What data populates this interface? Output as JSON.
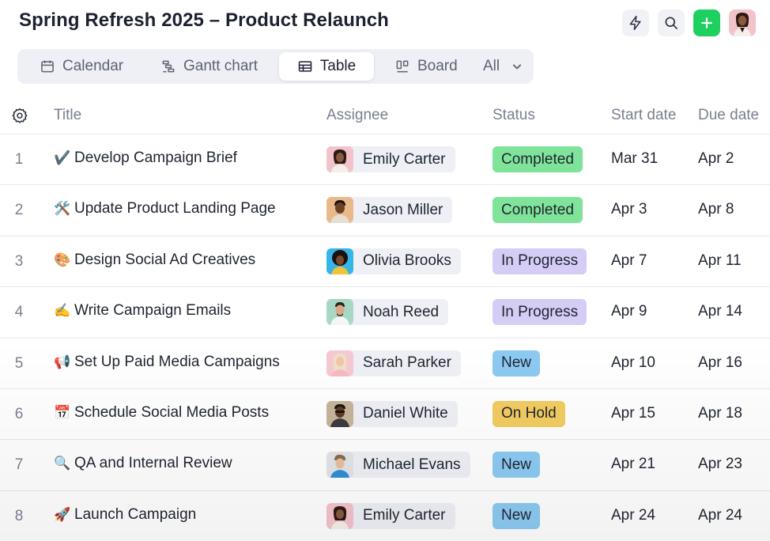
{
  "header": {
    "title": "Spring Refresh 2025 – Product Relaunch",
    "icons": {
      "automation": "bolt-icon",
      "search": "search-icon",
      "add": "plus-icon"
    }
  },
  "tabs": [
    {
      "label": "Calendar",
      "icon": "calendar-icon"
    },
    {
      "label": "Gantt chart",
      "icon": "gantt-icon"
    },
    {
      "label": "Table",
      "icon": "table-icon",
      "active": true
    },
    {
      "label": "Board",
      "icon": "board-icon"
    },
    {
      "label": "All",
      "icon": "chevron-down-icon"
    }
  ],
  "columns": {
    "title": "Title",
    "assignee": "Assignee",
    "status": "Status",
    "start": "Start date",
    "due": "Due date"
  },
  "colors": {
    "completed": "#7fe49a",
    "in_progress": "#d6cdf6",
    "new": "#8ccaf2",
    "on_hold": "#f2cc61",
    "add_button": "#1dd05f"
  },
  "rows": [
    {
      "num": "1",
      "emoji": "✔️",
      "title": "Develop Campaign Brief",
      "assignee": "Emily Carter",
      "status": "Completed",
      "start": "Mar 31",
      "due": "Apr 2"
    },
    {
      "num": "2",
      "emoji": "🛠️",
      "title": "Update Product Landing Page",
      "assignee": "Jason Miller",
      "status": "Completed",
      "start": "Apr 3",
      "due": "Apr 8"
    },
    {
      "num": "3",
      "emoji": "🎨",
      "title": "Design Social Ad Creatives",
      "assignee": "Olivia Brooks",
      "status": "In Progress",
      "start": "Apr 7",
      "due": "Apr 11"
    },
    {
      "num": "4",
      "emoji": "✍️",
      "title": "Write Campaign Emails",
      "assignee": "Noah Reed",
      "status": "In Progress",
      "start": "Apr 9",
      "due": "Apr 14"
    },
    {
      "num": "5",
      "emoji": "📢",
      "title": "Set Up Paid Media Campaigns",
      "assignee": "Sarah Parker",
      "status": "New",
      "start": "Apr 10",
      "due": "Apr 16"
    },
    {
      "num": "6",
      "emoji": "📅",
      "title": "Schedule Social Media Posts",
      "assignee": "Daniel White",
      "status": "On Hold",
      "start": "Apr 15",
      "due": "Apr 18"
    },
    {
      "num": "7",
      "emoji": "🔍",
      "title": "QA and Internal Review",
      "assignee": "Michael Evans",
      "status": "New",
      "start": "Apr 21",
      "due": "Apr 23"
    },
    {
      "num": "8",
      "emoji": "🚀",
      "title": "Launch Campaign",
      "assignee": "Emily Carter",
      "status": "New",
      "start": "Apr 24",
      "due": "Apr 24"
    }
  ]
}
